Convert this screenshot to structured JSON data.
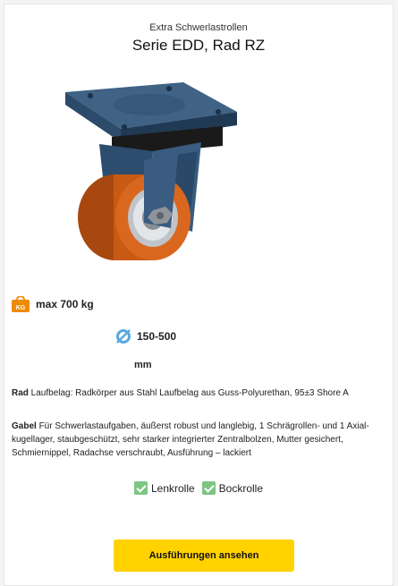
{
  "header": {
    "subtitle": "Extra Schwerlastrollen",
    "title": "Serie EDD, Rad RZ"
  },
  "specs": {
    "kg_badge": "KG",
    "load": "max 700 kg",
    "diameter": "150-500",
    "diameter_unit": "mm"
  },
  "details": {
    "rad_label": "Rad",
    "rad_text": " Laufbelag: Radkörper aus Stahl Laufbelag aus Guss-Polyurethan, 95±3 Shore A",
    "gabel_label": "Gabel",
    "gabel_text": " Für Schwerlastaufgaben, äußerst robust und langlebig, 1 Schrägrollen- und 1 Axial-kugellager, staubgeschützt, sehr starker integrierter Zentralbolzen, Mutter gesichert, Schmiernippel, Radachse verschraubt, Ausführung – lackiert"
  },
  "types": [
    "Lenkrolle",
    "Bockrolle"
  ],
  "cta": {
    "label": "Ausführungen ansehen"
  },
  "colors": {
    "accent": "#ffd200",
    "kg_icon": "#f08a00",
    "diameter_icon": "#5aa9e0",
    "check": "#7ec483",
    "plate": "#2c4b6a",
    "wheel_tread": "#c85a14"
  }
}
